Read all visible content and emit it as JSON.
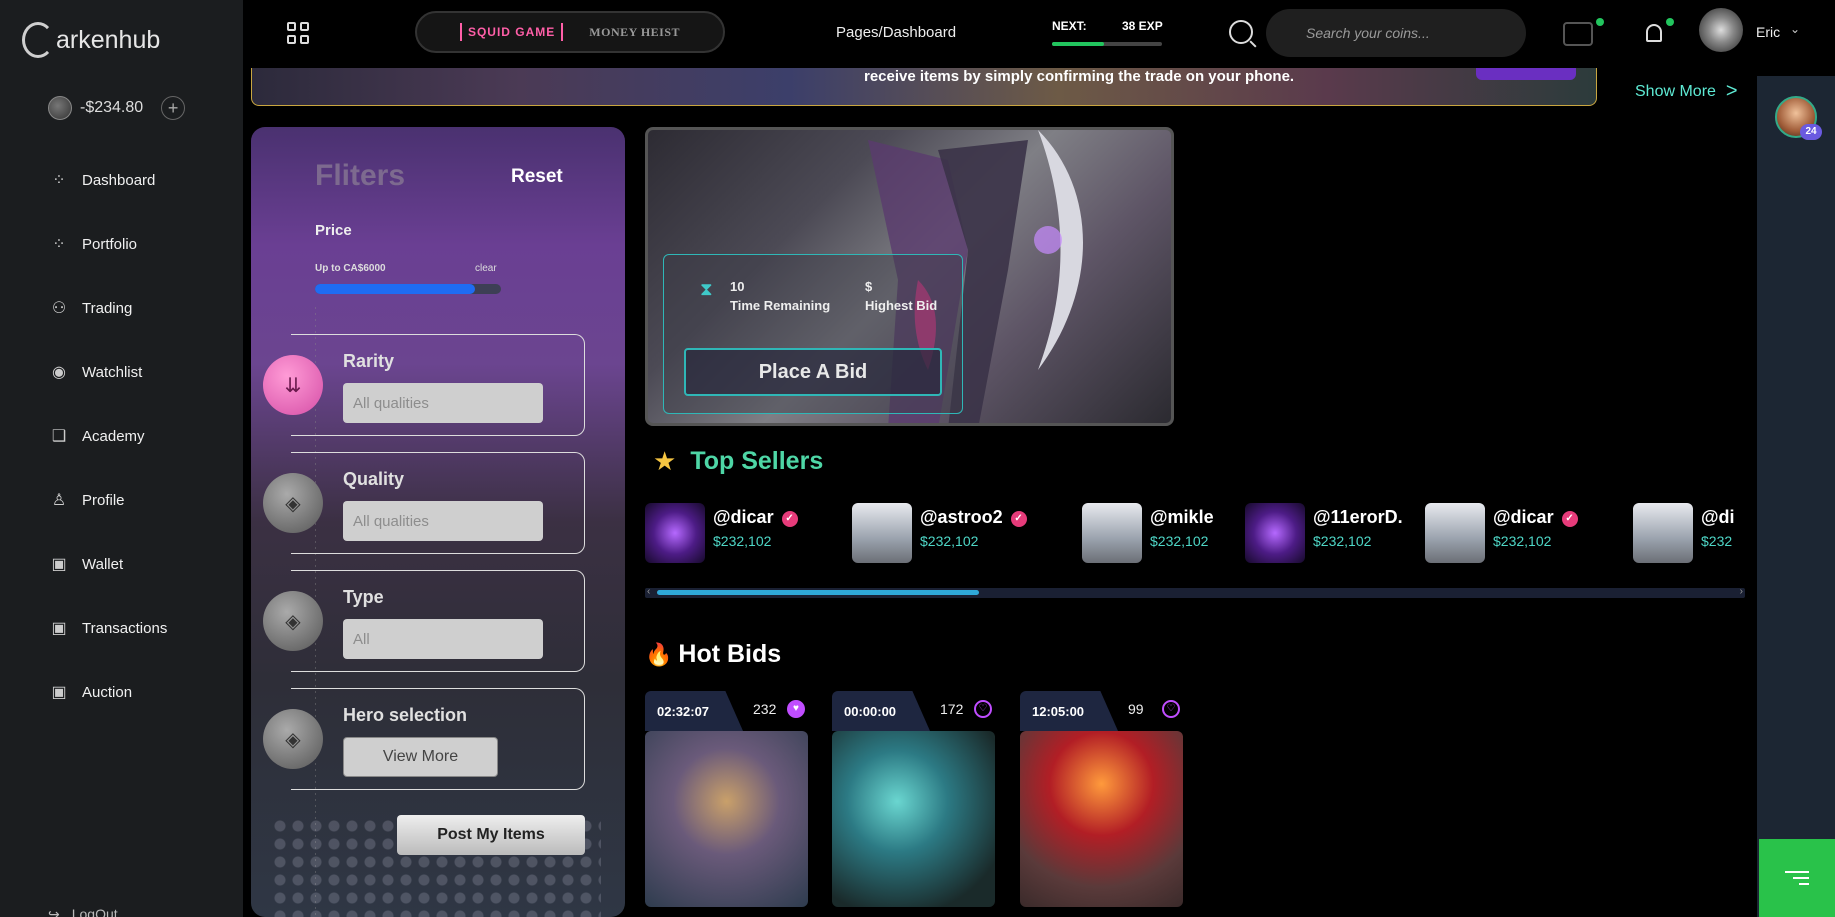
{
  "brand": {
    "name": "arkenhub"
  },
  "sidebar": {
    "balance": "-$234.80",
    "items": [
      {
        "label": "Dashboard",
        "icon": "dots-icon"
      },
      {
        "label": "Portfolio",
        "icon": "dots-icon"
      },
      {
        "label": "Trading",
        "icon": "trading-icon"
      },
      {
        "label": "Watchlist",
        "icon": "eye-icon"
      },
      {
        "label": "Academy",
        "icon": "book-icon"
      },
      {
        "label": "Profile",
        "icon": "user-icon"
      },
      {
        "label": "Wallet",
        "icon": "wallet-icon"
      },
      {
        "label": "Transactions",
        "icon": "wallet-icon"
      },
      {
        "label": "Auction",
        "icon": "wallet-icon"
      }
    ],
    "logout": "LogOut"
  },
  "header": {
    "games": [
      "SQUID GAME",
      "MONEY HEIST"
    ],
    "breadcrumb": "Pages/Dashboard",
    "next_label": "NEXT:",
    "next_exp": "38 EXP",
    "exp_progress": 0.47,
    "search_placeholder": "Search your coins...",
    "user_name": "Eric"
  },
  "banner": {
    "text": "receive items by simply confirming the trade on your phone.",
    "show_more": "Show More",
    "show_more_arrow": ">"
  },
  "filters": {
    "title": "Fliters",
    "reset": "Reset",
    "price_label": "Price",
    "price_range": "Up to CA$6000",
    "price_clear": "clear",
    "price_fill": 0.86,
    "rarity": {
      "label": "Rarity",
      "value": "All qualities"
    },
    "quality": {
      "label": "Quality",
      "value": "All qualities"
    },
    "type": {
      "label": "Type",
      "value": "All"
    },
    "hero": {
      "label": "Hero selection",
      "button": "View More"
    },
    "post_items": "Post My Items"
  },
  "featured": {
    "time_value": "10",
    "time_label": "Time Remaining",
    "bid_value": "$",
    "bid_label": "Highest Bid",
    "place_bid": "Place A Bid"
  },
  "top_sellers": {
    "title": "Top Sellers",
    "sellers": [
      {
        "name": "@dicar",
        "price": "$232,102",
        "verified": true,
        "img": "purple"
      },
      {
        "name": "@astroo2",
        "price": "$232,102",
        "verified": true,
        "img": "grey"
      },
      {
        "name": "@mikle",
        "price": "$232,102",
        "verified": false,
        "img": "grey"
      },
      {
        "name": "@11erorD.",
        "price": "$232,102",
        "verified": false,
        "img": "purple"
      },
      {
        "name": "@dicar",
        "price": "$232,102",
        "verified": true,
        "img": "grey"
      },
      {
        "name": "@di",
        "price": "$232",
        "verified": false,
        "img": "grey"
      }
    ]
  },
  "hot_bids": {
    "title": "Hot Bids",
    "cards": [
      {
        "timer": "02:32:07",
        "likes": "232",
        "liked": true
      },
      {
        "timer": "00:00:00",
        "likes": "172",
        "liked": false
      },
      {
        "timer": "12:05:00",
        "likes": "99",
        "liked": false
      }
    ]
  },
  "right_rail": {
    "badge": "24"
  },
  "colors": {
    "accent": "#4ed6a6",
    "brand_green": "#29c24a",
    "pink": "#ff5fa8",
    "progress_blue": "#1f6cf2"
  }
}
